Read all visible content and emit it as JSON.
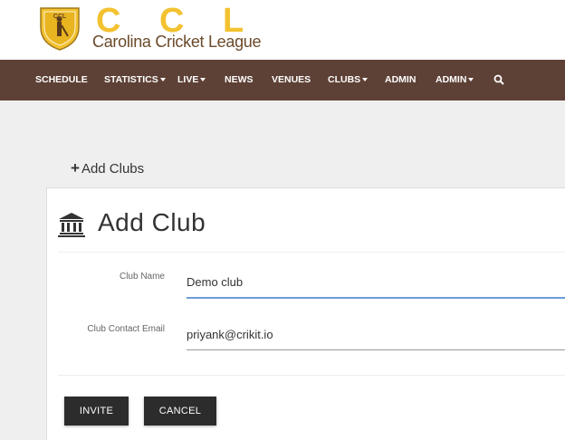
{
  "brand": {
    "shield_text": "CCL",
    "letters": [
      "C",
      "C",
      "L"
    ],
    "tagline": "Carolina Cricket League",
    "colors": {
      "gold": "#f3c230",
      "brown": "#6b4a2a"
    }
  },
  "nav": {
    "background": "#5e4136",
    "items": [
      {
        "label": "SCHEDULE",
        "dropdown": false
      },
      {
        "label": "STATISTICS",
        "dropdown": true
      },
      {
        "label": "LIVE",
        "dropdown": true
      },
      {
        "label": "NEWS",
        "dropdown": false
      },
      {
        "label": "VENUES",
        "dropdown": false
      },
      {
        "label": "CLUBS",
        "dropdown": true
      },
      {
        "label": "ADMIN",
        "dropdown": false
      },
      {
        "label": "ADMIN",
        "dropdown": true
      }
    ],
    "search_icon": "search-icon"
  },
  "page": {
    "heading": "Add Clubs",
    "heading_icon": "plus-icon"
  },
  "form": {
    "title": "Add Club",
    "title_icon": "bank-icon",
    "club_name_label": "Club Name",
    "club_name_value": "Demo club",
    "contact_email_label": "Club Contact Email",
    "contact_email_value": "priyank@crikit.io",
    "invite_label": "INVITE",
    "cancel_label": "CANCEL"
  }
}
